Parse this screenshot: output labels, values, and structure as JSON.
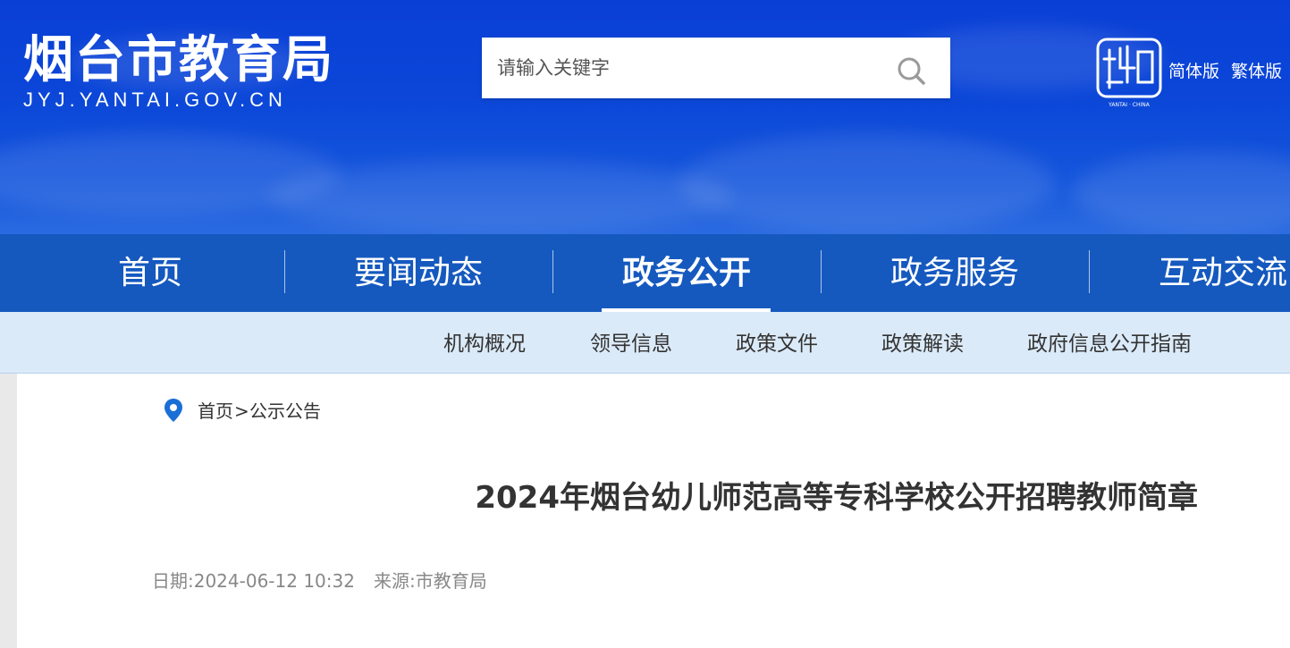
{
  "header": {
    "site_title": "烟台市教育局",
    "site_url": "JYJ.YANTAI.GOV.CN",
    "search_placeholder": "请输入关键字",
    "emblem_caption": "YANTAI · CHINA",
    "lang_simplified": "简体版",
    "lang_traditional": "繁体版"
  },
  "nav": {
    "items": [
      {
        "label": "首页"
      },
      {
        "label": "要闻动态"
      },
      {
        "label": "政务公开"
      },
      {
        "label": "政务服务"
      },
      {
        "label": "互动交流"
      }
    ],
    "active": "政务公开"
  },
  "subnav": {
    "items": [
      {
        "label": "机构概况"
      },
      {
        "label": "领导信息"
      },
      {
        "label": "政策文件"
      },
      {
        "label": "政策解读"
      },
      {
        "label": "政府信息公开指南"
      }
    ]
  },
  "breadcrumb": {
    "home": "首页",
    "separator": ">",
    "current": "公示公告"
  },
  "article": {
    "title": "2024年烟台幼儿师范高等专科学校公开招聘教师简章",
    "date": "日期:2024-06-12 10:32",
    "source": "来源:市教育局"
  },
  "colors": {
    "banner_blue": "#0b46d8",
    "nav_blue": "#1559bf",
    "subnav_bg": "#dbeaf8",
    "pin_blue": "#1a6fd6"
  },
  "icons": {
    "search": "search-icon",
    "emblem": "emblem-icon",
    "location": "location-pin-icon"
  }
}
